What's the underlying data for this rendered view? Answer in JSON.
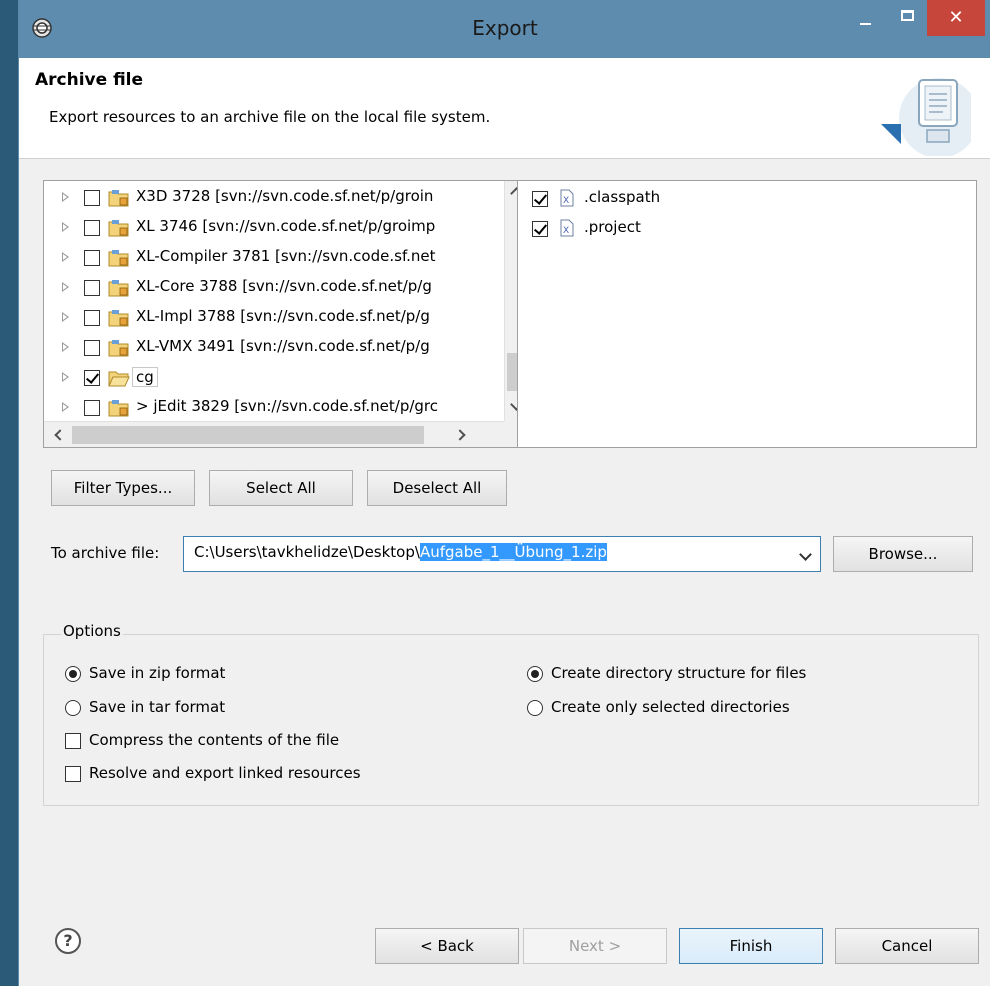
{
  "window": {
    "title": "Export",
    "close_glyph": "✕",
    "header_title": "Archive file",
    "header_description": "Export resources to an archive file on the local file system."
  },
  "tree": {
    "items": [
      {
        "label": "X3D 3728 [svn://svn.code.sf.net/p/groin",
        "checked": false
      },
      {
        "label": "XL 3746 [svn://svn.code.sf.net/p/groimp",
        "checked": false
      },
      {
        "label": "XL-Compiler 3781 [svn://svn.code.sf.net",
        "checked": false
      },
      {
        "label": "XL-Core 3788 [svn://svn.code.sf.net/p/g",
        "checked": false
      },
      {
        "label": "XL-Impl 3788 [svn://svn.code.sf.net/p/g",
        "checked": false
      },
      {
        "label": "XL-VMX 3491 [svn://svn.code.sf.net/p/g",
        "checked": false
      },
      {
        "label": "cg",
        "checked": true
      },
      {
        "label": "> jEdit 3829 [svn://svn.code.sf.net/p/grc",
        "checked": false
      }
    ]
  },
  "files": {
    "items": [
      {
        "label": ".classpath",
        "checked": true
      },
      {
        "label": ".project",
        "checked": true
      }
    ]
  },
  "buttons": {
    "filter_types": "Filter Types...",
    "select_all": "Select All",
    "deselect_all": "Deselect All",
    "browse": "Browse...",
    "back": "< Back",
    "next": "Next >",
    "finish": "Finish",
    "cancel": "Cancel"
  },
  "archive": {
    "label": "To archive file:",
    "path_prefix": "C:\\Users\\tavkhelidze\\Desktop\\",
    "path_selected": "Aufgabe_1__Übung_1.zip"
  },
  "options": {
    "legend": "Options",
    "save_zip": "Save in zip format",
    "save_tar": "Save in tar format",
    "compress": "Compress the contents of the file",
    "resolve_links": "Resolve and export linked resources",
    "create_dir_structure": "Create directory structure for files",
    "create_selected_dirs": "Create only selected directories"
  },
  "help_glyph": "?",
  "colors": {
    "titlebar": "#5e8cae",
    "close_button": "#c7463b",
    "selection": "#3399ff",
    "default_button_border": "#3c7fb1"
  }
}
